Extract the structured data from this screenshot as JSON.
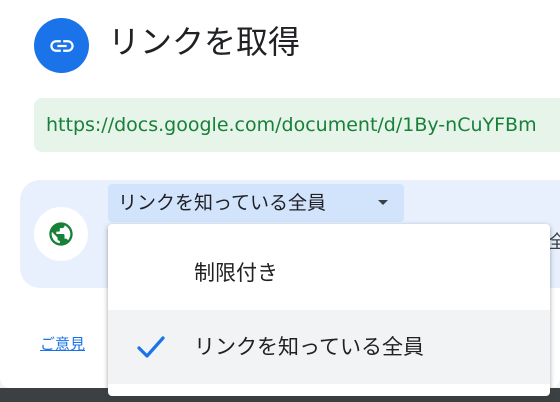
{
  "dialog": {
    "title": "リンクを取得",
    "link_icon": "link-icon",
    "url": "https://docs.google.com/document/d/1By-nCuYFBm",
    "access": {
      "globe_icon": "globe-icon",
      "selected": "リンクを知っている全員",
      "dropdown_icon": "caret-down-icon",
      "role_partial": "全"
    },
    "feedback_label": "ご意見"
  },
  "menu": {
    "options": [
      {
        "label": "制限付き",
        "selected": false
      },
      {
        "label": "リンクを知っている全員",
        "selected": true
      }
    ],
    "check_icon": "check-icon"
  },
  "colors": {
    "accent": "#1a73e8",
    "url_text": "#188038",
    "url_bg": "#e6f4ea",
    "panel_bg": "#e8f0fe",
    "globe": "#188038"
  }
}
